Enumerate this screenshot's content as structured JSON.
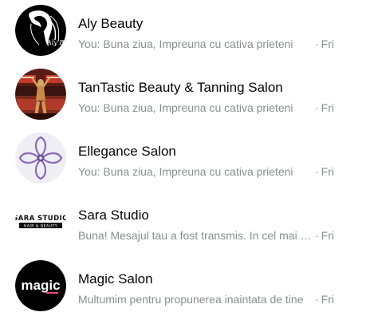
{
  "conversations": [
    {
      "name": "Aly Beauty",
      "preview": "You: Buna ziua, Impreuna cu cativa prieteni",
      "time": "Fri",
      "avatar_icon": "aly-beauty-logo",
      "avatar_text": "Aly Be"
    },
    {
      "name": "TanTastic Beauty & Tanning Salon",
      "preview": "You: Buna ziua, Impreuna cu cativa prieteni",
      "time": "Fri",
      "avatar_icon": "tanning-salon-photo"
    },
    {
      "name": "Ellegance Salon",
      "preview": "You: Buna ziua, Impreuna cu cativa prieteni",
      "time": "Fri",
      "avatar_icon": "flower-logo"
    },
    {
      "name": "Sara Studio",
      "preview": "Buna! Mesajul tau a fost transmis. In cel mai scurt timp",
      "time": "Fri",
      "avatar_icon": "sara-studio-logo",
      "avatar_text_top": "SARA STUDIO",
      "avatar_text_bottom": "HAIR & BEAUTY"
    },
    {
      "name": "Magic Salon",
      "preview": "Multumim pentru propunerea inaintata de tine",
      "time": "Fri",
      "avatar_icon": "magic-logo",
      "avatar_text": "magic"
    }
  ],
  "colors": {
    "name": "#050505",
    "secondary": "#8a8d91",
    "magic_accent": "#e8457a",
    "ellegance_purple": "#8a6bb5"
  }
}
